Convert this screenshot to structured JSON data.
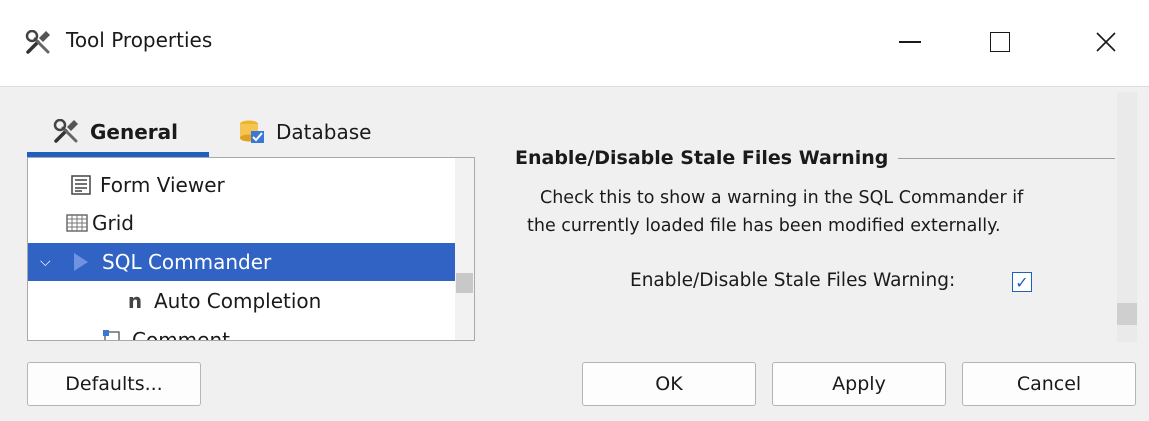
{
  "window": {
    "title": "Tool Properties"
  },
  "tabs": [
    {
      "label": "General",
      "icon": "tools-icon",
      "active": true
    },
    {
      "label": "Database",
      "icon": "database-icon",
      "active": false
    }
  ],
  "tree": {
    "items": [
      {
        "label": "Form Viewer",
        "icon": "form-icon"
      },
      {
        "label": "Grid",
        "icon": "grid-icon"
      },
      {
        "label": "SQL Commander",
        "icon": "sql-commander-icon",
        "selected": true,
        "expanded": true
      },
      {
        "label": "Auto Completion",
        "icon": "n-icon"
      },
      {
        "label": "Comment",
        "icon": "comment-icon"
      }
    ]
  },
  "section": {
    "title": "Enable/Disable Stale Files Warning",
    "description_line1": "Check this to show a warning in the SQL Commander if",
    "description_line2": "the currently loaded file has been modified externally.",
    "option_label": "Enable/Disable Stale Files Warning:",
    "option_checked": true
  },
  "buttons": {
    "defaults": "Defaults...",
    "ok": "OK",
    "apply": "Apply",
    "cancel": "Cancel"
  },
  "colors": {
    "accent": "#1f5fbf",
    "selection": "#3163c5"
  }
}
